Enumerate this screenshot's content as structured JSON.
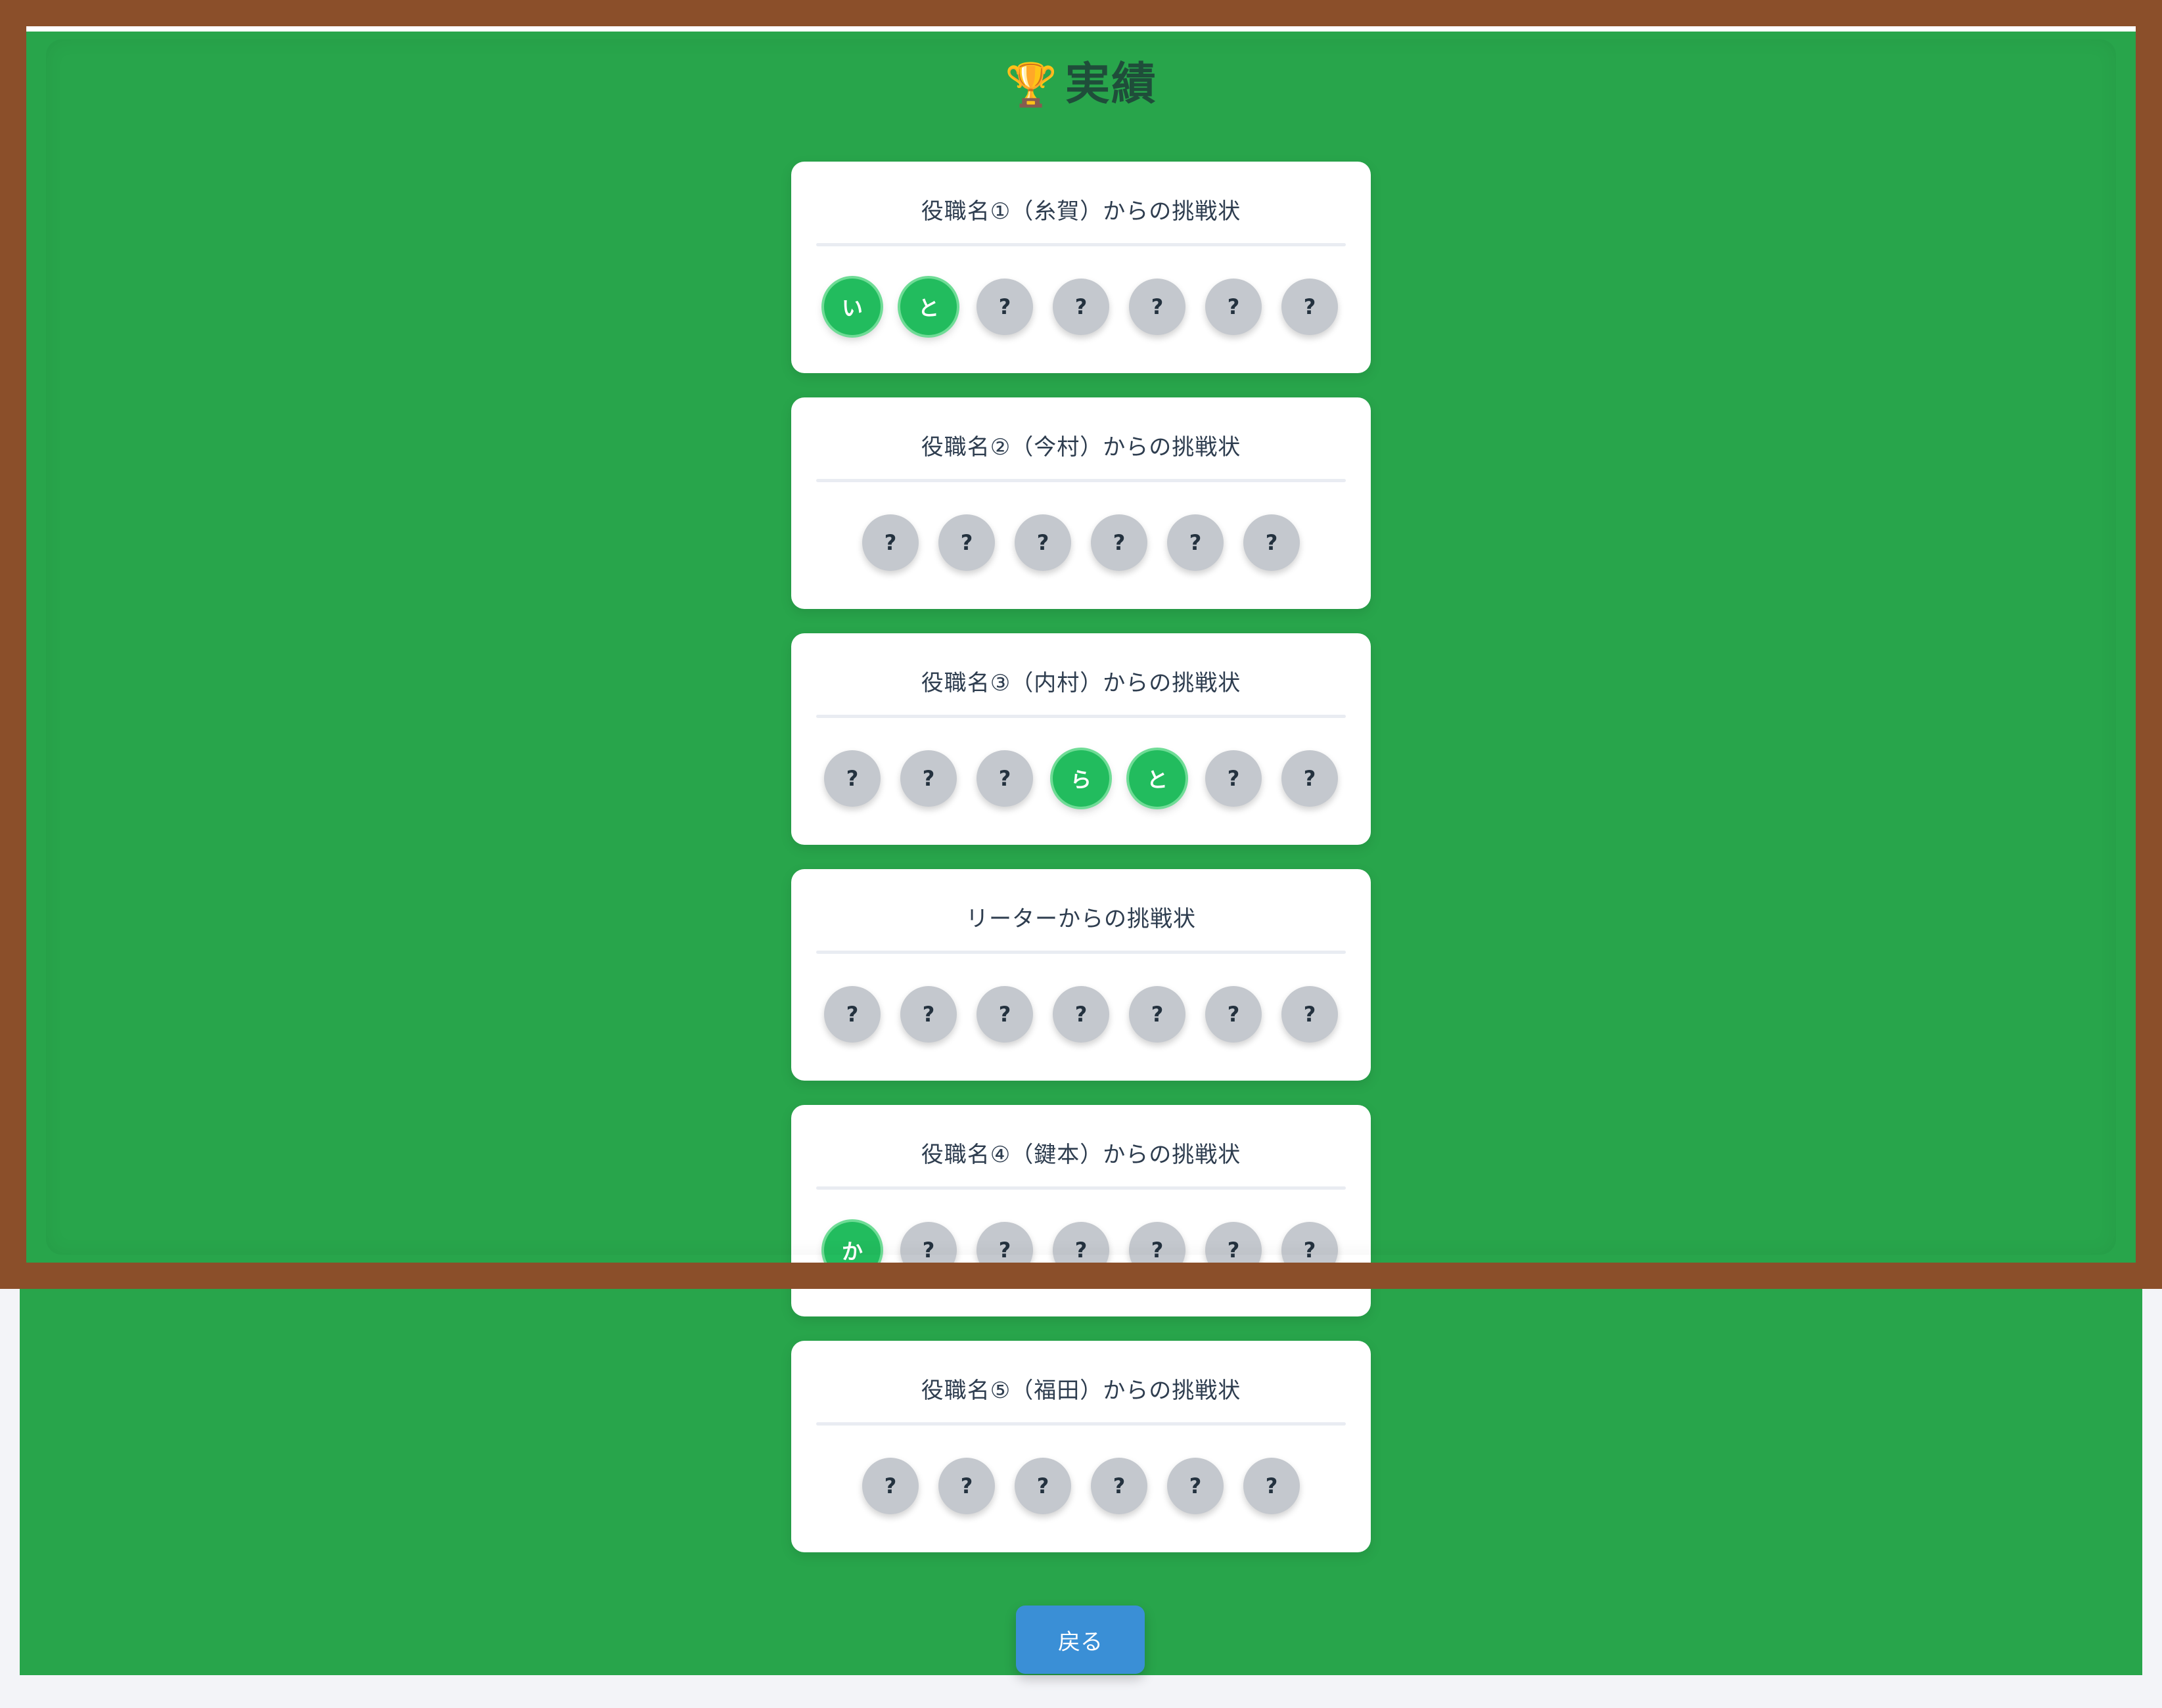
{
  "header": {
    "icon": "trophy-icon",
    "icon_glyph": "🏆",
    "title": "実績"
  },
  "challenges": [
    {
      "title": "役職名①（糸賀）からの挑戦状",
      "letters": [
        "い",
        "と",
        "?",
        "?",
        "?",
        "?",
        "?"
      ],
      "unlocked": [
        true,
        true,
        false,
        false,
        false,
        false,
        false
      ]
    },
    {
      "title": "役職名②（今村）からの挑戦状",
      "letters": [
        "?",
        "?",
        "?",
        "?",
        "?",
        "?"
      ],
      "unlocked": [
        false,
        false,
        false,
        false,
        false,
        false
      ]
    },
    {
      "title": "役職名③（内村）からの挑戦状",
      "letters": [
        "?",
        "?",
        "?",
        "ら",
        "と",
        "?",
        "?"
      ],
      "unlocked": [
        false,
        false,
        false,
        true,
        true,
        false,
        false
      ]
    },
    {
      "title": "リーターからの挑戦状",
      "letters": [
        "?",
        "?",
        "?",
        "?",
        "?",
        "?",
        "?"
      ],
      "unlocked": [
        false,
        false,
        false,
        false,
        false,
        false,
        false
      ]
    },
    {
      "title": "役職名④（鍵本）からの挑戦状",
      "letters": [
        "か",
        "?",
        "?",
        "?",
        "?",
        "?",
        "?"
      ],
      "unlocked": [
        true,
        false,
        false,
        false,
        false,
        false,
        false
      ]
    },
    {
      "title": "役職名⑤（福田）からの挑戦状",
      "letters": [
        "?",
        "?",
        "?",
        "?",
        "?",
        "?"
      ],
      "unlocked": [
        false,
        false,
        false,
        false,
        false,
        false
      ]
    }
  ],
  "footer": {
    "back_label": "戻る"
  },
  "colors": {
    "field": "#28a54b",
    "frame": "#8b4f2a",
    "unlocked": "#22bc5e",
    "locked": "#c4c8ce",
    "button": "#3a8fd6"
  }
}
